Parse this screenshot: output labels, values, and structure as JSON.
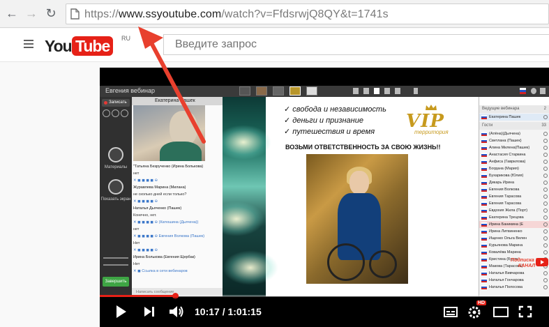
{
  "browser": {
    "url_scheme": "https://",
    "url_host": "www.ssyoutube.com",
    "url_path": "/watch?v=FfdsrwjQ8QY&t=1741s"
  },
  "yt": {
    "logo_you": "You",
    "logo_tube": "Tube",
    "region": "RU",
    "search_placeholder": "Введите запрос",
    "brand_color": "#e62117"
  },
  "webinar": {
    "title": "Евгения вебинар",
    "record_label": "Записать",
    "materials_label": "Материалы",
    "screen_label": "Показать экран",
    "join_label": "Завершить",
    "cam_name": "Екатерина Пашек",
    "chat_input_placeholder": "Написать сообщение",
    "chat": [
      {
        "t": "\"Татьяна Безрученко (Ирина Болькова)",
        "c": "msg"
      },
      {
        "t": "нет",
        "c": ""
      },
      {
        "t": "✕ ◼ ◼ ◼ ◼ ⊖",
        "c": "icons"
      },
      {
        "t": "Журавлева Марина (Милана)",
        "c": "msg"
      },
      {
        "t": "не сколько дней если только?",
        "c": ""
      },
      {
        "t": "✕ ◼ ◼ ◼ ◼ ⊖",
        "c": "icons"
      },
      {
        "t": "Наталья Дьяченко (Пашек)",
        "c": "msg"
      },
      {
        "t": "Конечно, нет.",
        "c": ""
      },
      {
        "t": "✕ ◼ ◼ ◼ ◼ ⊖   (Катюшина (Дьячена))",
        "c": "icons"
      },
      {
        "t": "нет",
        "c": ""
      },
      {
        "t": "✕ ◼ ◼ ◼ ◼ ⊖   Евгения Волкова (Пашек)",
        "c": "icons"
      },
      {
        "t": "Нет",
        "c": ""
      },
      {
        "t": "✕ ◼ ◼ ◼ ◼ ⊖",
        "c": "icons"
      },
      {
        "t": "Ирина Болькова (Евгения Щербак)",
        "c": "msg"
      },
      {
        "t": "Нет",
        "c": ""
      },
      {
        "t": "✕ ◼ Ссылка в сети вебинаров",
        "c": "icons"
      }
    ],
    "slide": {
      "bullets": [
        "✓ свобода и независимость",
        "✓ деньги и признание",
        "✓ путешествия и время"
      ],
      "brand": "VIP",
      "brand_sub": "территория",
      "headline": "ВОЗЬМИ ОТВЕТСТВЕННОСТЬ ЗА СВОЮ ЖИЗНЬ!!",
      "gold_color": "#c79a1e"
    },
    "people": {
      "leaders_label": "Ведущие вебинара",
      "leaders_count": "2",
      "guests_label": "Гости",
      "guests_count": "33",
      "me": "Екатерина Пашек",
      "list": [
        "(Алёна)(Дьячена)",
        "Светлана (Пашек)",
        "Алина Милена(Пашек)",
        "Анастасия Старкина",
        "Анфиса (Гаврилова)",
        "Богдана (Мария)",
        "Бухарикова (Юлия)",
        "Дикарь Ирина",
        "Евгения Волкова",
        "Евгения Тарасова",
        "Евгения Тарасова",
        "Евдохия Жила (Порт)",
        "Екатерина Трецова",
        "Ирина Баникина (Е",
        "Ирина Литвиненко",
        "Ищенко Ольга Велен",
        "Курьянова Марина",
        "Ковалёва Марина",
        "Кристина (Буряк",
        "Макова (Тарасова)",
        "Наталья Вивчарова",
        "Наталья Гончарова",
        "Наталья Полосова"
      ],
      "watermark": "Подписка НА КАНАЛ"
    }
  },
  "player": {
    "time_current": "10:17",
    "time_sep": " / ",
    "time_total": "1:01:15",
    "progress_fraction": 0.168,
    "hd_badge": "HD"
  }
}
